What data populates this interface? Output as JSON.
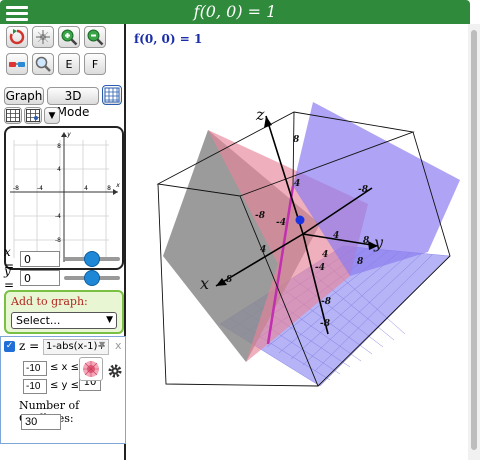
{
  "header": {
    "title": "f(0, 0) = 1"
  },
  "toolbar": {
    "e_label": "E",
    "f_label": "F",
    "graph_label": "Graph",
    "mode_label": "3D Mode"
  },
  "mini_graph": {
    "x_ticks": [
      "-8",
      "-4",
      "4",
      "8"
    ],
    "y_ticks": [
      "8",
      "4",
      "-4",
      "-8"
    ],
    "x_axis_label": "x",
    "y_axis_label": "y"
  },
  "sliders": {
    "x": {
      "label": "x =",
      "value": "0",
      "position": 0.5
    },
    "y": {
      "label": "y =",
      "value": "0",
      "position": 0.5
    }
  },
  "add_to_graph": {
    "title": "Add to graph:",
    "select_value": "Select..."
  },
  "function": {
    "var_label": "z =",
    "expression": "1-abs(x-1)+",
    "close_label": "x",
    "x_min": "-10",
    "x_max_label": "≤ x ≤",
    "y_min": "-10",
    "y_max_label": "≤ y ≤",
    "y_max": "10",
    "gridlines_label": "Number of Gridlines:",
    "gridlines_value": "30"
  },
  "plot": {
    "value_readout": "f(0, 0) = 1",
    "axis_labels": {
      "z": "z",
      "y": "y",
      "x": "x"
    },
    "tick_labels": [
      "-8",
      "-4",
      "4",
      "8",
      "-8",
      "4",
      "8",
      "8",
      "4",
      "-4",
      "-8",
      "-8",
      "4",
      "8"
    ]
  },
  "colors": {
    "header": "#2f8a3c",
    "plane_blue": "#8c7cf0",
    "plane_pink": "#e8849a",
    "plane_gray": "#8a8a8a",
    "floor": "#a9a7f4"
  }
}
